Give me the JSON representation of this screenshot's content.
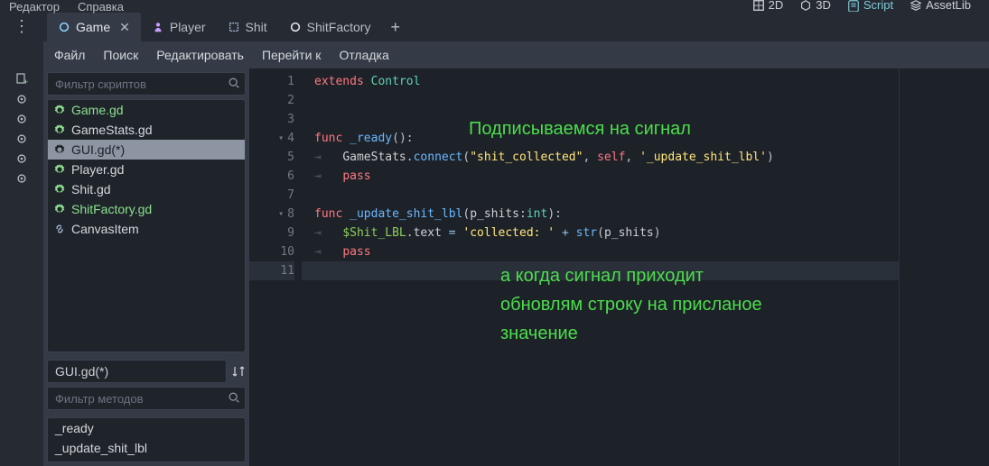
{
  "topmenu": {
    "editor": "Редактор",
    "help": "Справка"
  },
  "views": {
    "v2d": "2D",
    "v3d": "3D",
    "script": "Script",
    "assetlib": "AssetLib"
  },
  "tabs": [
    {
      "label": "Game",
      "active": true
    },
    {
      "label": "Player",
      "active": false
    },
    {
      "label": "Shit",
      "active": false
    },
    {
      "label": "ShitFactory",
      "active": false
    }
  ],
  "menubar": {
    "file": "Файл",
    "search": "Поиск",
    "edit": "Редактировать",
    "goto": "Перейти к",
    "debug": "Отладка"
  },
  "sidebar": {
    "filter_scripts_placeholder": "Фильтр скриптов",
    "scripts": [
      {
        "label": "Game.gd",
        "highlighted": true
      },
      {
        "label": "GameStats.gd",
        "highlighted": false
      },
      {
        "label": "GUI.gd(*)",
        "selected": true
      },
      {
        "label": "Player.gd",
        "highlighted": false
      },
      {
        "label": "Shit.gd",
        "highlighted": false
      },
      {
        "label": "ShitFactory.gd",
        "highlighted": true
      },
      {
        "label": "CanvasItem",
        "icon": "link"
      }
    ],
    "current_file": "GUI.gd(*)",
    "filter_methods_placeholder": "Фильтр методов",
    "methods": [
      "_ready",
      "_update_shit_lbl"
    ]
  },
  "code": {
    "lines": [
      {
        "n": 1,
        "tokens": [
          [
            "kw",
            "extends"
          ],
          [
            "",
            " "
          ],
          [
            "cls",
            "Control"
          ]
        ]
      },
      {
        "n": 2,
        "tokens": []
      },
      {
        "n": 3,
        "tokens": []
      },
      {
        "n": 4,
        "fold": true,
        "tokens": [
          [
            "kw",
            "func"
          ],
          [
            "",
            " "
          ],
          [
            "funcname",
            "_ready"
          ],
          [
            "punct",
            "("
          ],
          [
            "punct",
            ")"
          ],
          [
            "punct",
            ":"
          ]
        ]
      },
      {
        "n": 5,
        "tokens": [
          [
            "indent-marker",
            "⇥   "
          ],
          [
            "",
            "GameStats"
          ],
          [
            "punct",
            "."
          ],
          [
            "fn",
            "connect"
          ],
          [
            "punct",
            "("
          ],
          [
            "str",
            "\"shit_collected\""
          ],
          [
            "punct",
            ","
          ],
          [
            "",
            " "
          ],
          [
            "self",
            "self"
          ],
          [
            "punct",
            ","
          ],
          [
            "",
            " "
          ],
          [
            "str",
            "'_update_shit_lbl'"
          ],
          [
            "punct",
            ")"
          ]
        ]
      },
      {
        "n": 6,
        "tokens": [
          [
            "indent-marker",
            "⇥   "
          ],
          [
            "kw",
            "pass"
          ]
        ]
      },
      {
        "n": 7,
        "tokens": []
      },
      {
        "n": 8,
        "fold": true,
        "tokens": [
          [
            "kw",
            "func"
          ],
          [
            "",
            " "
          ],
          [
            "funcname",
            "_update_shit_lbl"
          ],
          [
            "punct",
            "("
          ],
          [
            "",
            "p_shits"
          ],
          [
            "punct",
            ":"
          ],
          [
            "type",
            "int"
          ],
          [
            "punct",
            ")"
          ],
          [
            "punct",
            ":"
          ]
        ]
      },
      {
        "n": 9,
        "tokens": [
          [
            "indent-marker",
            "⇥   "
          ],
          [
            "node",
            "$Shit_LBL"
          ],
          [
            "punct",
            "."
          ],
          [
            "",
            "text "
          ],
          [
            "op",
            "="
          ],
          [
            "",
            " "
          ],
          [
            "str",
            "'collected: '"
          ],
          [
            "",
            " "
          ],
          [
            "op",
            "+"
          ],
          [
            "",
            " "
          ],
          [
            "fn",
            "str"
          ],
          [
            "punct",
            "("
          ],
          [
            "",
            "p_shits"
          ],
          [
            "punct",
            ")"
          ]
        ]
      },
      {
        "n": 10,
        "tokens": [
          [
            "indent-marker",
            "⇥   "
          ],
          [
            "kw",
            "pass"
          ]
        ]
      },
      {
        "n": 11,
        "current": true,
        "tokens": []
      }
    ]
  },
  "annotations": {
    "a1": "Подписываемся на сигнал",
    "a2": "а когда сигнал приходит\nобновлям строку на присланое\nзначение"
  }
}
